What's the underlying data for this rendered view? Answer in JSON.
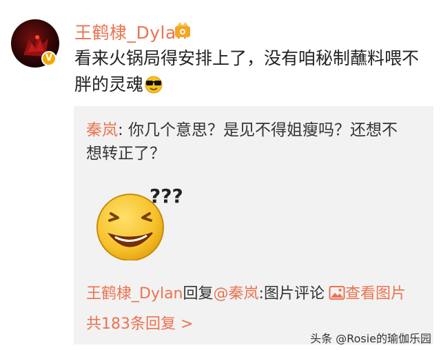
{
  "post": {
    "username": "王鹤棣_Dylan",
    "comment_text": "看来火锅局得安排上了，没有咱秘制蘸料喂不胖的灵魂",
    "verified_badge": "V",
    "icons": {
      "level": "level-badge-icon",
      "verified": "verified-badge-icon",
      "emoji": "cool-sunglasses-emoji-icon"
    }
  },
  "reply": {
    "author": "秦岚",
    "separator": ":",
    "text": " 你几个意思？是见不得姐瘦吗？还想不想转正了？",
    "sub_reply": {
      "author": "王鹤棣_Dylan",
      "verb": "回复",
      "mention": "@秦岚",
      "suffix": ":图片评论",
      "view_image": "查看图片"
    },
    "total_replies": "共183条回复 >"
  },
  "watermark": "头条 @Rosie的瑜伽乐园",
  "colors": {
    "accent": "#eb7350",
    "reply_bg": "#f2f2f2",
    "badge": "#f2a900"
  }
}
